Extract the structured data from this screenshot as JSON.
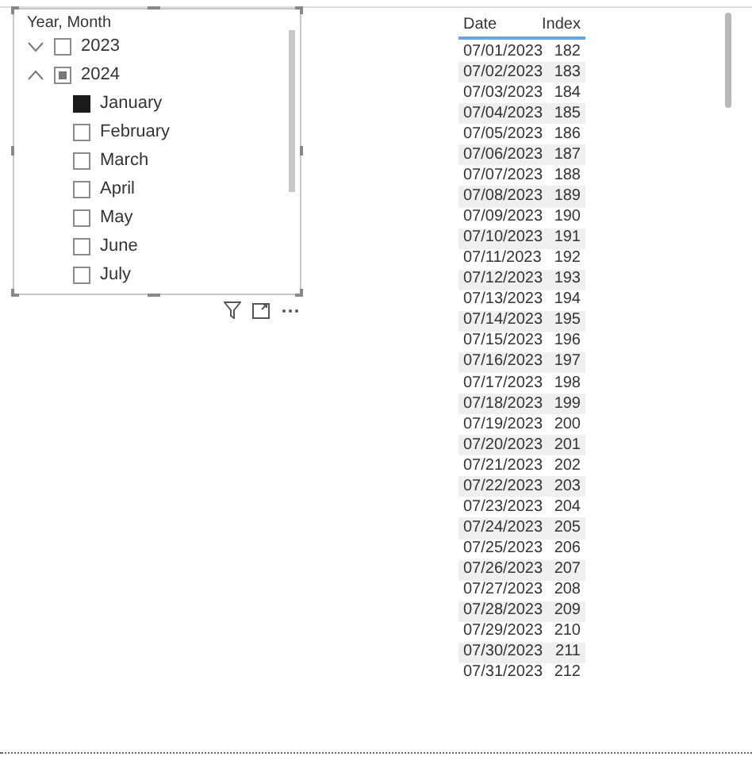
{
  "slicer": {
    "title": "Year, Month",
    "items": [
      {
        "label": "2023",
        "expanded": false,
        "partial": false
      },
      {
        "label": "2024",
        "expanded": true,
        "partial": true,
        "children": [
          {
            "label": "January",
            "checked": true
          },
          {
            "label": "February",
            "checked": false
          },
          {
            "label": "March",
            "checked": false
          },
          {
            "label": "April",
            "checked": false
          },
          {
            "label": "May",
            "checked": false
          },
          {
            "label": "June",
            "checked": false
          },
          {
            "label": "July",
            "checked": false
          }
        ]
      }
    ]
  },
  "table": {
    "columns": [
      "Date",
      "Index"
    ],
    "rows": [
      [
        "07/01/2023",
        "182"
      ],
      [
        "07/02/2023",
        "183"
      ],
      [
        "07/03/2023",
        "184"
      ],
      [
        "07/04/2023",
        "185"
      ],
      [
        "07/05/2023",
        "186"
      ],
      [
        "07/06/2023",
        "187"
      ],
      [
        "07/07/2023",
        "188"
      ],
      [
        "07/08/2023",
        "189"
      ],
      [
        "07/09/2023",
        "190"
      ],
      [
        "07/10/2023",
        "191"
      ],
      [
        "07/11/2023",
        "192"
      ],
      [
        "07/12/2023",
        "193"
      ],
      [
        "07/13/2023",
        "194"
      ],
      [
        "07/14/2023",
        "195"
      ],
      [
        "07/15/2023",
        "196"
      ],
      [
        "07/16/2023",
        "197"
      ],
      [
        "07/17/2023",
        "198"
      ],
      [
        "07/18/2023",
        "199"
      ],
      [
        "07/19/2023",
        "200"
      ],
      [
        "07/20/2023",
        "201"
      ],
      [
        "07/21/2023",
        "202"
      ],
      [
        "07/22/2023",
        "203"
      ],
      [
        "07/23/2023",
        "204"
      ],
      [
        "07/24/2023",
        "205"
      ],
      [
        "07/25/2023",
        "206"
      ],
      [
        "07/26/2023",
        "207"
      ],
      [
        "07/27/2023",
        "208"
      ],
      [
        "07/28/2023",
        "209"
      ],
      [
        "07/29/2023",
        "210"
      ],
      [
        "07/30/2023",
        "211"
      ],
      [
        "07/31/2023",
        "212"
      ]
    ]
  }
}
